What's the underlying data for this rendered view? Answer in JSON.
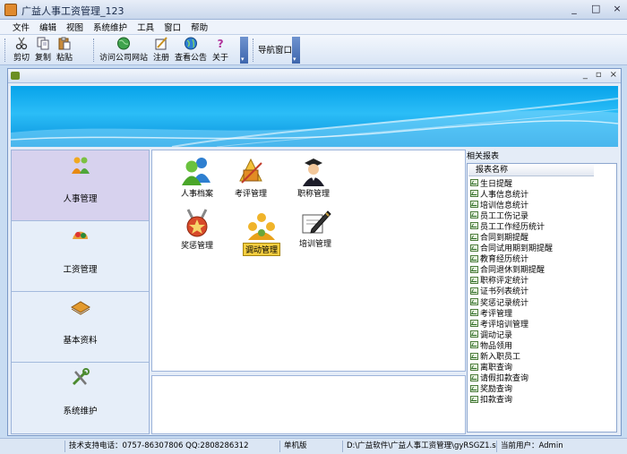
{
  "window": {
    "title": "广益人事工资管理_123",
    "min": "_",
    "max": "□",
    "close": "×"
  },
  "menu": [
    "文件",
    "编辑",
    "视图",
    "系统维护",
    "工具",
    "窗口",
    "帮助"
  ],
  "toolbar": {
    "cut": "剪切",
    "copy": "复制",
    "paste": "粘贴",
    "visit_site": "访问公司网站",
    "register": "注册",
    "notice": "查看公告",
    "about": "关于",
    "nav_window": "导航窗口"
  },
  "child_window": {
    "min": "_",
    "restore": "▫",
    "close": "×"
  },
  "nav": [
    {
      "label": "人事管理",
      "icon": "people-icon",
      "selected": true
    },
    {
      "label": "工资管理",
      "icon": "money-icon",
      "selected": false
    },
    {
      "label": "基本资料",
      "icon": "book-icon",
      "selected": false
    },
    {
      "label": "系统维护",
      "icon": "tools-icon",
      "selected": false
    }
  ],
  "apps": [
    {
      "label": "人事档案",
      "icon": "users-icon"
    },
    {
      "label": "考评管理",
      "icon": "evaluation-icon"
    },
    {
      "label": "职称管理",
      "icon": "graduate-icon"
    },
    {
      "label": "奖惩管理",
      "icon": "medal-icon"
    },
    {
      "label": "调动管理",
      "icon": "transfer-icon",
      "selected": true
    },
    {
      "label": "培训管理",
      "icon": "pen-icon"
    }
  ],
  "reports": {
    "panel_title": "相关报表",
    "column_header": "报表名称",
    "items": [
      "生日提醒",
      "人事信息统计",
      "培训信息统计",
      "员工工伤记录",
      "员工工作经历统计",
      "合同到期提醒",
      "合同试用期到期提醒",
      "教育经历统计",
      "合同退休到期提醒",
      "职称评定统计",
      "证书列表统计",
      "奖惩记录统计",
      "考评管理",
      "考评培训管理",
      "调动记录",
      "物品领用",
      "新入职员工",
      "离职查询",
      "请假扣款查询",
      "奖励查询",
      "扣款查询"
    ]
  },
  "status": {
    "support": "技术支持电话：0757-86307806 QQ:2808286312",
    "mode": "单机版",
    "path": "D:\\广益软件\\广益人事工资管理\\gyRSGZ1.sys",
    "user": "当前用户：Admin"
  }
}
